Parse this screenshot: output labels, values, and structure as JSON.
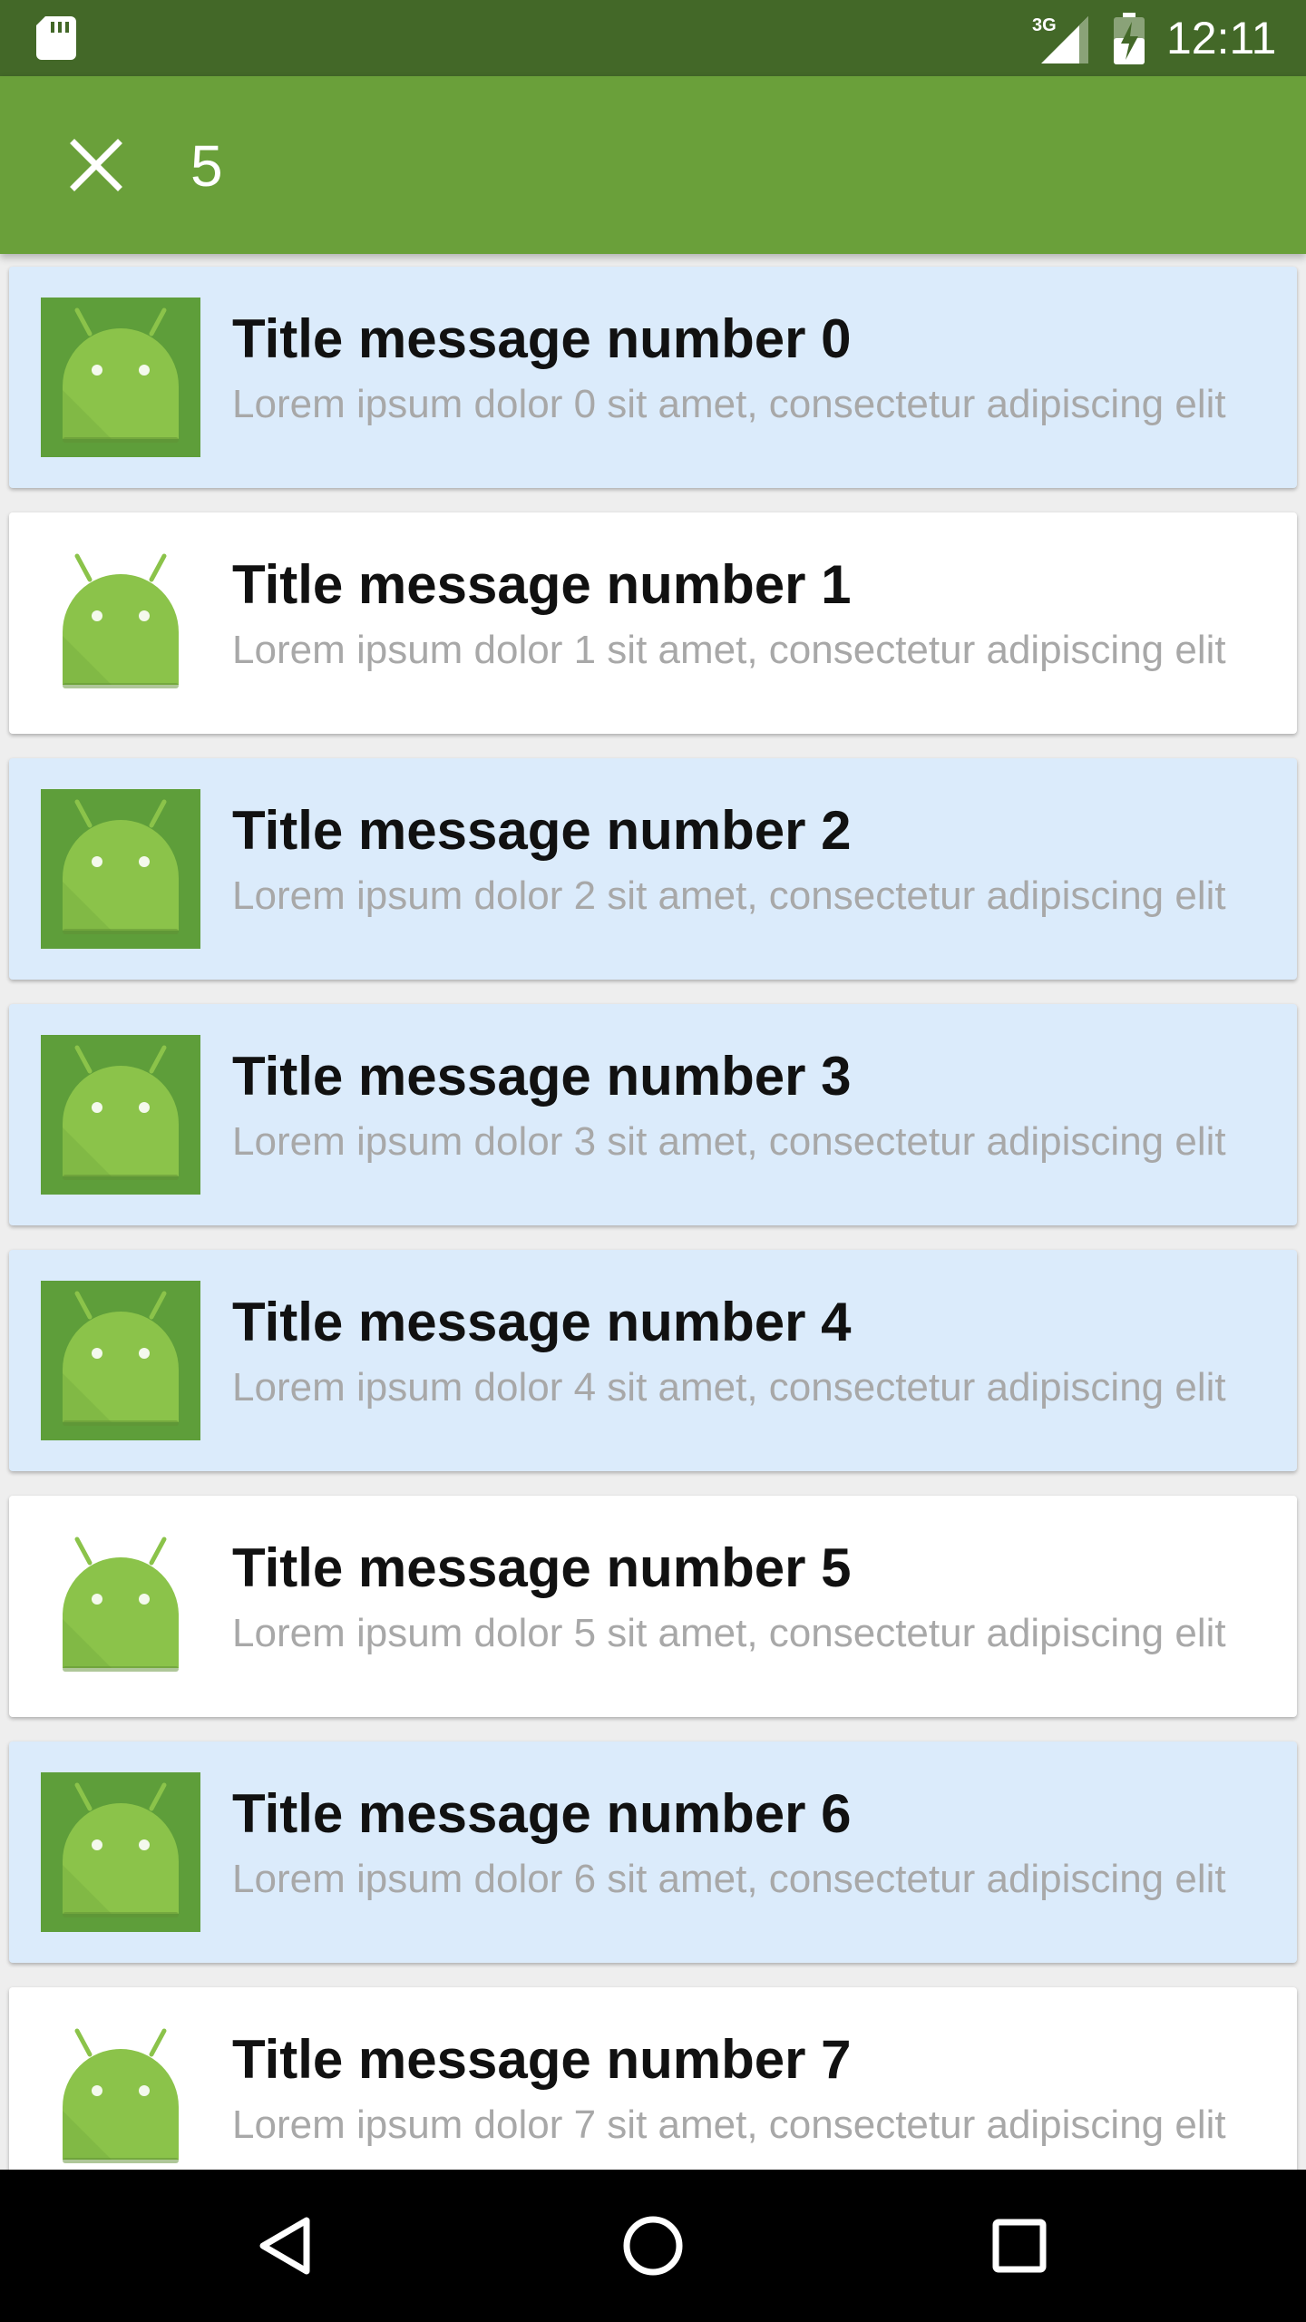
{
  "status_bar": {
    "time": "12:11",
    "network": "3G",
    "icons": [
      "sd-card-icon",
      "signal-icon",
      "battery-icon"
    ]
  },
  "app_bar": {
    "close_icon": "close-icon",
    "selection_count": "5",
    "background": "#6aa03a"
  },
  "colors": {
    "status_bar": "#436828",
    "selected_card": "#dbebfb",
    "unselected_card": "#ffffff",
    "icon_tile": "#5e9e3a"
  },
  "messages": [
    {
      "title": "Title message number 0",
      "subtitle": "Lorem ipsum dolor 0 sit amet, consectetur adipiscing elit",
      "selected": true
    },
    {
      "title": "Title message number 1",
      "subtitle": "Lorem ipsum dolor 1 sit amet, consectetur adipiscing elit",
      "selected": false
    },
    {
      "title": "Title message number 2",
      "subtitle": "Lorem ipsum dolor 2 sit amet, consectetur adipiscing elit",
      "selected": true
    },
    {
      "title": "Title message number 3",
      "subtitle": "Lorem ipsum dolor 3 sit amet, consectetur adipiscing elit",
      "selected": true
    },
    {
      "title": "Title message number 4",
      "subtitle": "Lorem ipsum dolor 4 sit amet, consectetur adipiscing elit",
      "selected": true
    },
    {
      "title": "Title message number 5",
      "subtitle": "Lorem ipsum dolor 5 sit amet, consectetur adipiscing elit",
      "selected": false
    },
    {
      "title": "Title message number 6",
      "subtitle": "Lorem ipsum dolor 6 sit amet, consectetur adipiscing elit",
      "selected": true
    },
    {
      "title": "Title message number 7",
      "subtitle": "Lorem ipsum dolor 7 sit amet, consectetur adipiscing elit",
      "selected": false
    }
  ],
  "nav_bar": {
    "buttons": [
      "back-icon",
      "home-icon",
      "recents-icon"
    ]
  }
}
